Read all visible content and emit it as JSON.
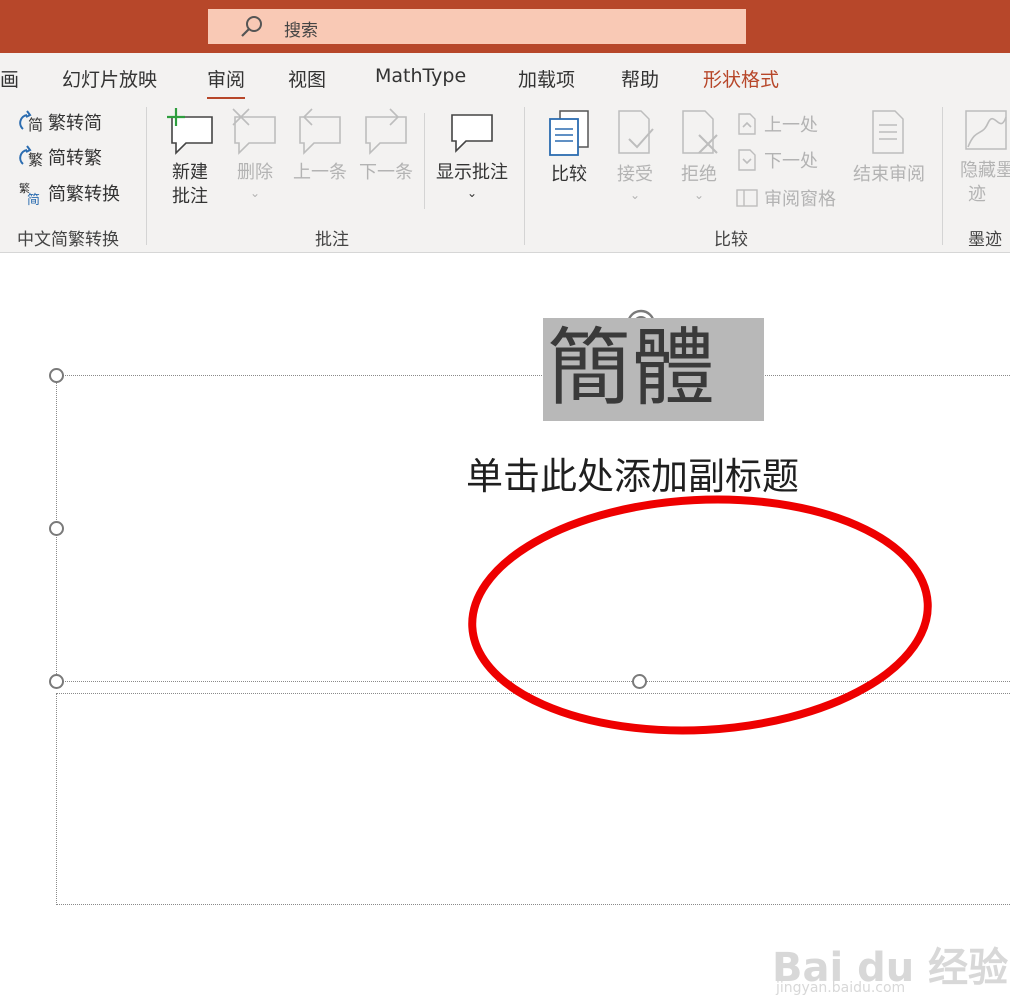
{
  "search": {
    "placeholder": "搜索",
    "icon": "search-icon"
  },
  "tabs": [
    {
      "label": "画"
    },
    {
      "label": "幻灯片放映"
    },
    {
      "label": "审阅"
    },
    {
      "label": "视图"
    },
    {
      "label": "MathType"
    },
    {
      "label": "加载项"
    },
    {
      "label": "帮助"
    },
    {
      "label": "形状格式"
    }
  ],
  "ribbon": {
    "chinese_conversion": {
      "label": "中文简繁转换",
      "items": [
        {
          "label": "繁转简",
          "icon": "trad-to-simp-icon"
        },
        {
          "label": "简转繁",
          "icon": "simp-to-trad-icon"
        },
        {
          "label": "简繁转换",
          "icon": "simp-trad-convert-icon"
        }
      ]
    },
    "comments": {
      "label": "批注",
      "new_comment": {
        "line1": "新建",
        "line2": "批注"
      },
      "delete": "删除",
      "previous": "上一条",
      "next": "下一条",
      "show_comments": "显示批注"
    },
    "compare": {
      "label": "比较",
      "compare": "比较",
      "accept": "接受",
      "reject": "拒绝",
      "previous_change": "上一处",
      "next_change": "下一处",
      "reviewing_pane": "审阅窗格",
      "end_review": "结束审阅"
    },
    "ink": {
      "label": "墨迹",
      "hide_ink": {
        "line1": "隐藏墨",
        "line2": "迹"
      }
    }
  },
  "slide": {
    "title_text": "簡體",
    "subtitle_placeholder": "单击此处添加副标题"
  },
  "watermark": {
    "main": "Bai du 经验",
    "sub": "jingyan.baidu.com"
  },
  "colors": {
    "accent": "#b7472a",
    "search_bg": "#f9c9b5",
    "annotation": "#ee0000"
  }
}
